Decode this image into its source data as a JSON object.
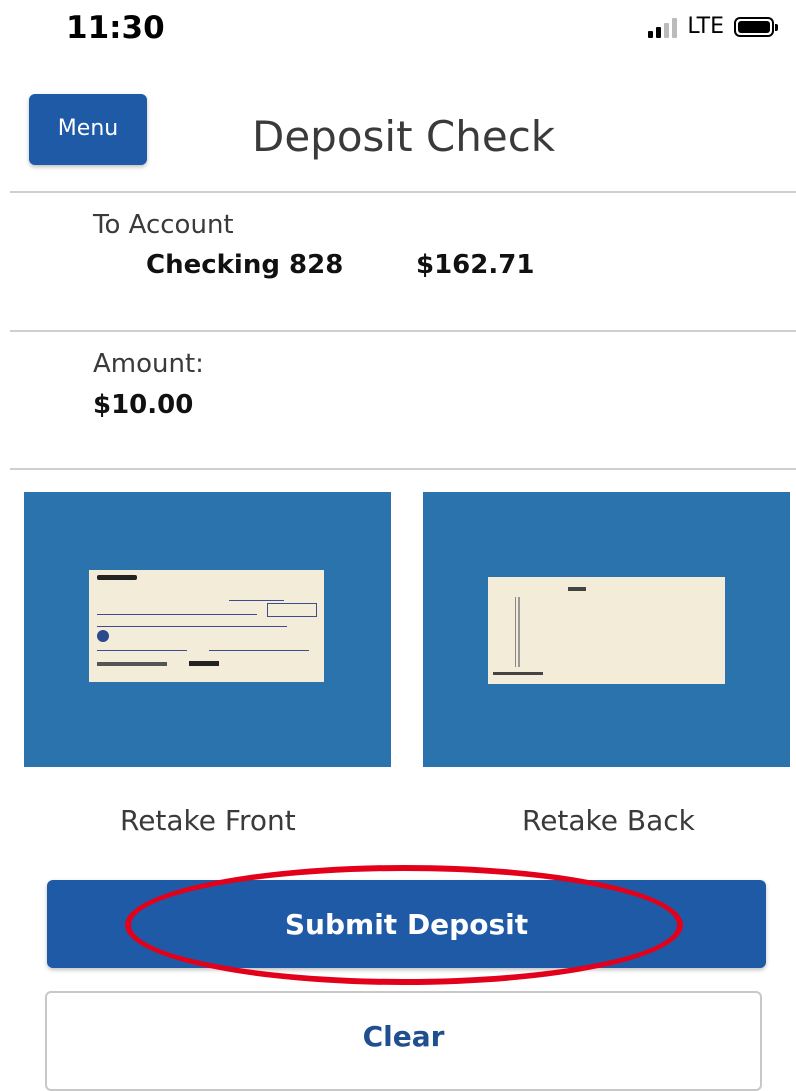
{
  "status_bar": {
    "time": "11:30",
    "network": "LTE"
  },
  "header": {
    "menu_label": "Menu",
    "title": "Deposit Check"
  },
  "account": {
    "label": "To Account",
    "name": "Checking 828",
    "balance": "$162.71"
  },
  "amount": {
    "label": "Amount:",
    "value": "$10.00"
  },
  "images": {
    "retake_front_label": "Retake Front",
    "retake_back_label": "Retake Back"
  },
  "actions": {
    "submit_label": "Submit Deposit",
    "clear_label": "Clear"
  },
  "colors": {
    "primary": "#1f5aa6",
    "highlight": "#e3001b",
    "check_background": "#2a73ad"
  }
}
